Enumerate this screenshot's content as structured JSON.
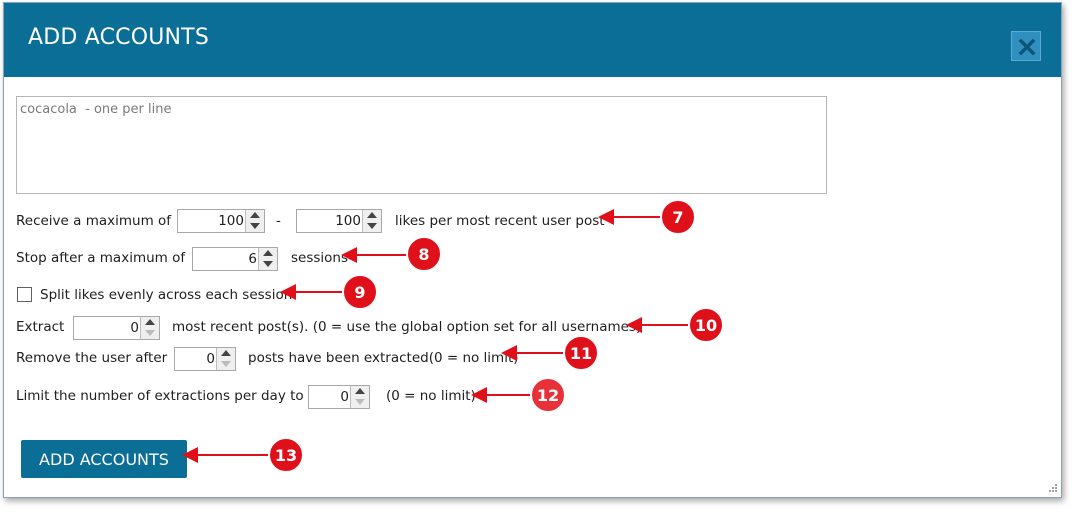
{
  "dialog": {
    "title": "ADD ACCOUNTS",
    "close_icon": "close-x-icon",
    "accent_color": "#0b6e96"
  },
  "usernames": {
    "placeholder": "cocacola  - one per line",
    "value": ""
  },
  "likes": {
    "label": "Receive a maximum of",
    "min_value": "100",
    "separator": "-",
    "max_value": "100",
    "suffix": "likes per most recent user post"
  },
  "sessions": {
    "label": "Stop after a maximum of",
    "value": "6",
    "suffix": "sessions"
  },
  "split": {
    "label": "Split likes evenly across each session",
    "checked": false
  },
  "extract": {
    "label": "Extract",
    "value": "0",
    "suffix": "most recent post(s). (0 = use the global option set for all usernames)"
  },
  "remove_user": {
    "label": "Remove the user after",
    "value": "0",
    "suffix": "posts have been extracted(0 = no limit)"
  },
  "limit_per_day": {
    "label": "Limit the number of extractions per day to",
    "value": "0",
    "suffix": "(0 = no limit)"
  },
  "submit": {
    "label": "ADD ACCOUNTS"
  },
  "annotations": [
    {
      "number": "7"
    },
    {
      "number": "8"
    },
    {
      "number": "9"
    },
    {
      "number": "10"
    },
    {
      "number": "11"
    },
    {
      "number": "12"
    },
    {
      "number": "13"
    }
  ],
  "annotation_color": "#e0101a"
}
